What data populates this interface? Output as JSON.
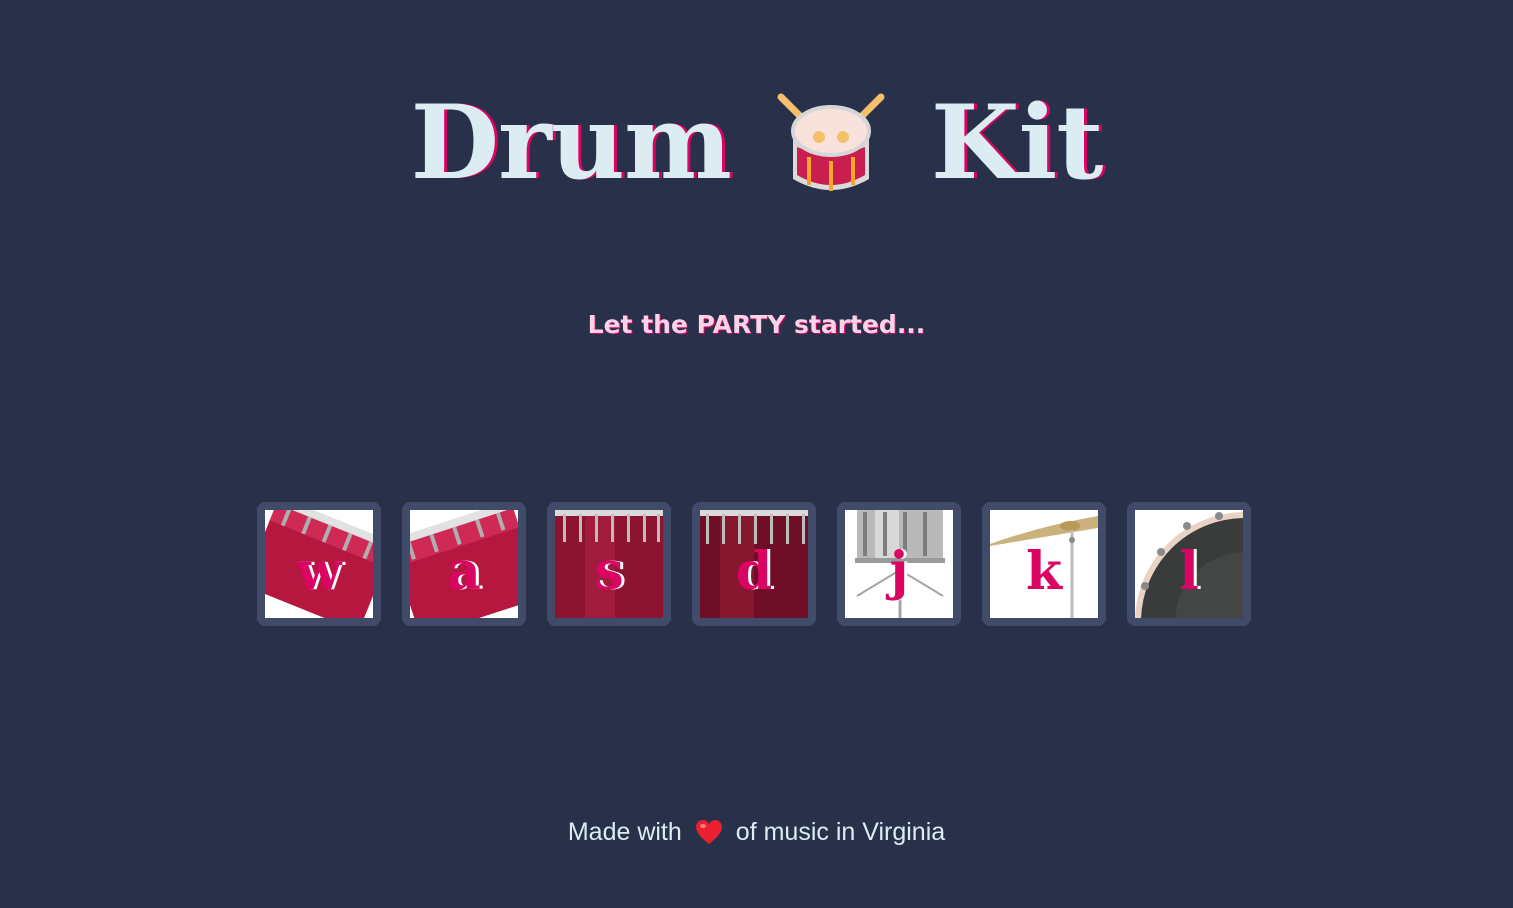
{
  "header": {
    "title_left": "Drum",
    "title_icon": "drum-icon",
    "title_right": "Kit",
    "subtitle": "Let the PARTY started..."
  },
  "drums": [
    {
      "key": "w",
      "name": "tom-1",
      "icon": "red-tom-drum"
    },
    {
      "key": "a",
      "name": "tom-2",
      "icon": "red-tom-drum"
    },
    {
      "key": "s",
      "name": "tom-3",
      "icon": "red-floor-tom"
    },
    {
      "key": "d",
      "name": "tom-4",
      "icon": "red-floor-tom"
    },
    {
      "key": "j",
      "name": "snare",
      "icon": "silver-snare-drum"
    },
    {
      "key": "k",
      "name": "crash",
      "icon": "cymbal"
    },
    {
      "key": "l",
      "name": "kick",
      "icon": "bass-drum"
    }
  ],
  "footer": {
    "prefix": "Made with",
    "icon": "heart-icon",
    "suffix": "of music in Virginia"
  },
  "colors": {
    "background": "#283149",
    "title": "#DBEDF3",
    "accent": "#DA0463",
    "subtitle": "#FBD3E9",
    "button_border": "#404B69"
  }
}
